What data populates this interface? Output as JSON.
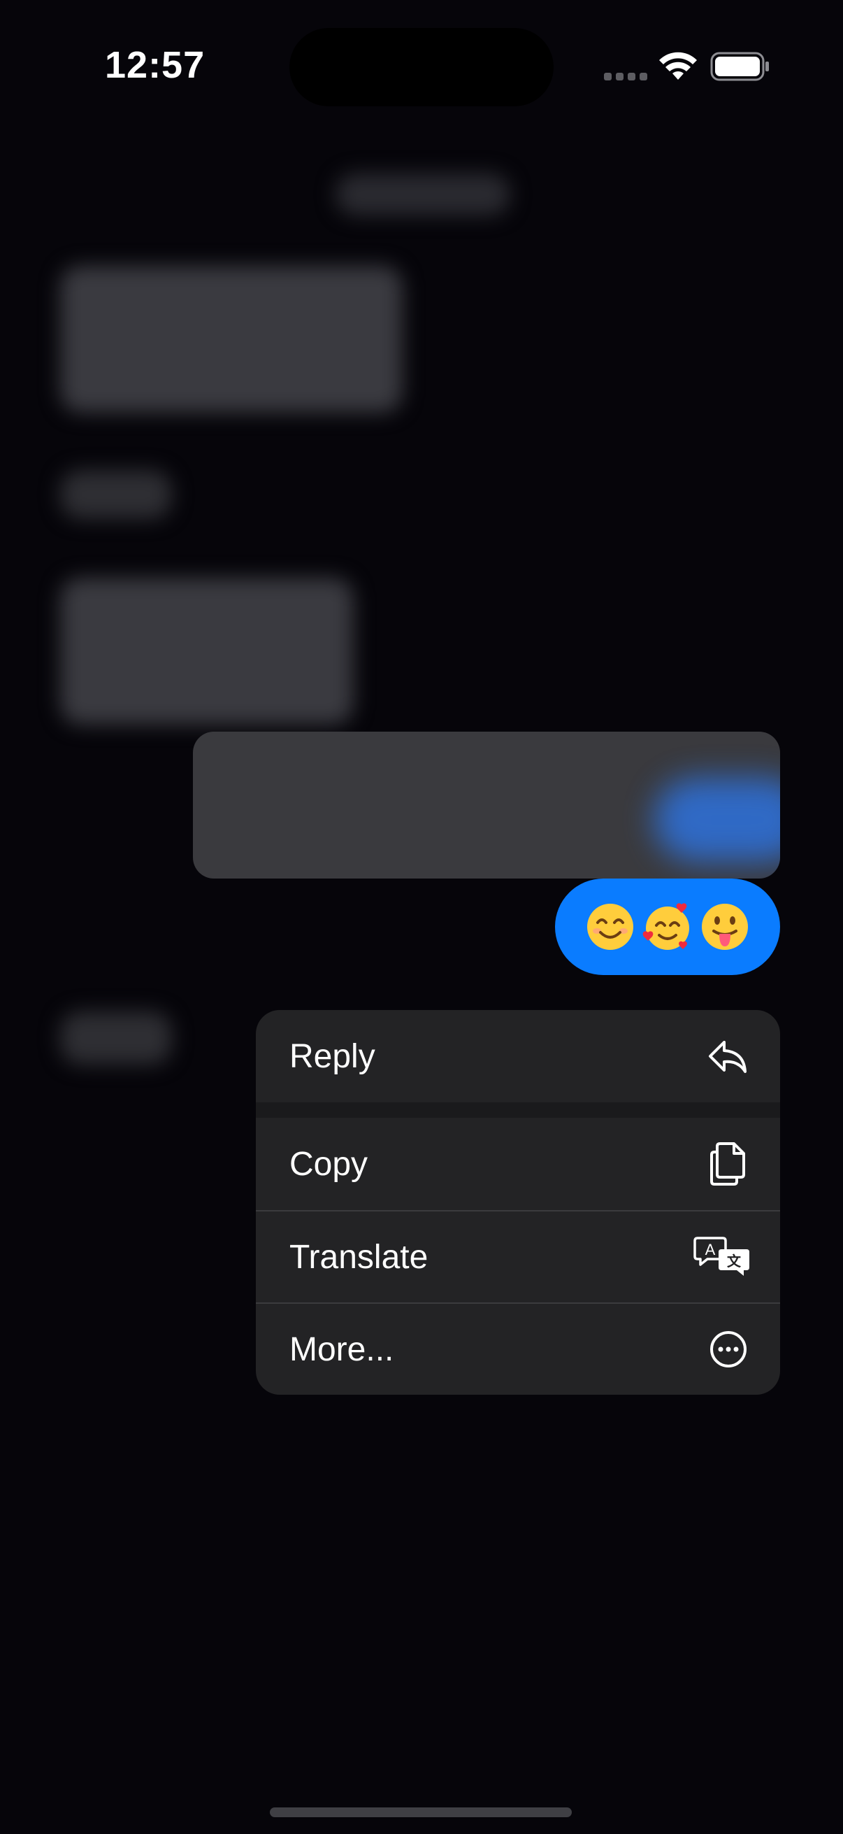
{
  "status_bar": {
    "time": "12:57",
    "signal_icon": "cellular-signal-icon",
    "wifi_icon": "wifi-icon",
    "battery_icon": "battery-icon"
  },
  "conversation": {
    "selected_message": {
      "text": "😊🥰😛",
      "bubble_color": "#0a7cff"
    }
  },
  "context_menu": {
    "items": [
      {
        "label": "Reply",
        "icon": "reply-arrow-icon"
      },
      {
        "label": "Copy",
        "icon": "copy-documents-icon"
      },
      {
        "label": "Translate",
        "icon": "translate-icon"
      },
      {
        "label": "More...",
        "icon": "more-ellipsis-circle-icon"
      }
    ]
  },
  "colors": {
    "background": "#06050a",
    "menu_background": "#232325",
    "accent": "#0a7cff"
  }
}
